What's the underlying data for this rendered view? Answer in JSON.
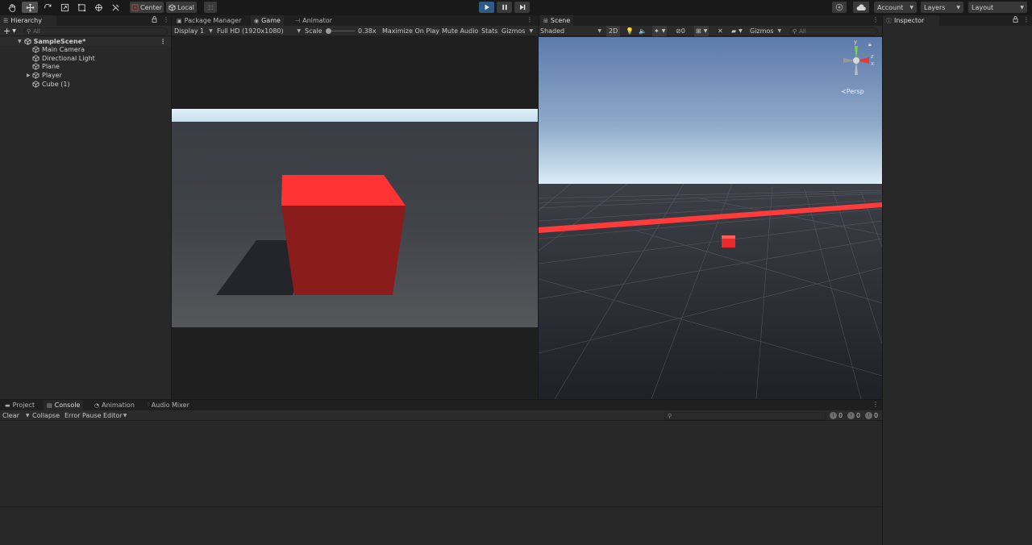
{
  "toolbar": {
    "tools": [
      "hand-tool",
      "move-tool",
      "rotate-tool",
      "scale-tool",
      "rect-tool",
      "transform-tool",
      "custom-tool"
    ],
    "pivot_label": "Center",
    "space_label": "Local",
    "account_label": "Account",
    "layers_label": "Layers",
    "layout_label": "Layout"
  },
  "hierarchy": {
    "tab_label": "Hierarchy",
    "add_label": "+",
    "search_placeholder": "All",
    "scene_name": "SampleScene*",
    "items": [
      {
        "label": "Main Camera",
        "has_children": false
      },
      {
        "label": "Directional Light",
        "has_children": false
      },
      {
        "label": "Plane",
        "has_children": false
      },
      {
        "label": "Player",
        "has_children": true
      },
      {
        "label": "Cube (1)",
        "has_children": false
      }
    ]
  },
  "game": {
    "tabs": [
      "Package Manager",
      "Game",
      "Animator"
    ],
    "display_label": "Display 1",
    "resolution_label": "Full HD (1920x1080)",
    "scale_label": "Scale",
    "scale_value": "0.38x",
    "maximize_label": "Maximize On Play",
    "mute_label": "Mute Audio",
    "stats_label": "Stats",
    "gizmos_label": "Gizmos"
  },
  "scene": {
    "tab_label": "Scene",
    "shading_label": "Shaded",
    "mode_2d_label": "2D",
    "hidden_count": "0",
    "gizmos_label": "Gizmos",
    "search_placeholder": "All",
    "persp_label": "Persp",
    "axis_y": "y",
    "axis_x": "x",
    "axis_z": "z"
  },
  "inspector": {
    "tab_label": "Inspector"
  },
  "console": {
    "tabs": [
      "Project",
      "Console",
      "Animation",
      "Audio Mixer"
    ],
    "clear_label": "Clear",
    "collapse_label": "Collapse",
    "error_pause_label": "Error Pause",
    "editor_label": "Editor",
    "log_count": "0",
    "warning_count": "0",
    "error_count": "0"
  },
  "colors": {
    "cube_red": "#ff3a3a",
    "play_active": "#2f5a86",
    "panel_bg": "#282828"
  }
}
